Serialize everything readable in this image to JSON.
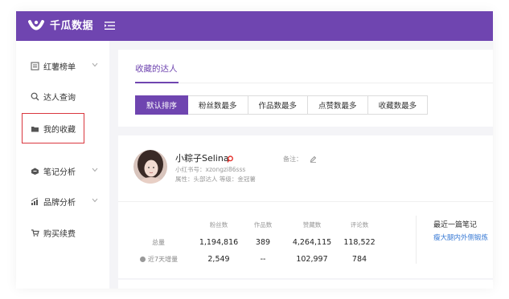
{
  "brand": {
    "name": "千瓜数据"
  },
  "colors": {
    "primary": "#6f45b0",
    "active_outline": "#d9363e",
    "link": "#3a7bd5"
  },
  "sidebar": {
    "items": [
      {
        "label": "红薯榜单",
        "icon": "list-icon",
        "has_chevron": true
      },
      {
        "label": "达人查询",
        "icon": "search-icon",
        "has_chevron": false
      },
      {
        "label": "我的收藏",
        "icon": "folder-icon",
        "has_chevron": false,
        "active": true
      },
      {
        "label": "笔记分析",
        "icon": "note-analysis-icon",
        "has_chevron": true
      },
      {
        "label": "品牌分析",
        "icon": "bar-chart-icon",
        "has_chevron": true
      },
      {
        "label": "购买续费",
        "icon": "cart-icon",
        "has_chevron": false
      }
    ]
  },
  "main": {
    "tab_title": "收藏的达人",
    "sort_buttons": [
      "默认排序",
      "粉丝数最多",
      "作品数最多",
      "点赞数最多",
      "收藏数最多"
    ]
  },
  "influencer": {
    "name": "小粽子Selina",
    "redbook_id": "小红书号：xzongzi86sss",
    "attributes": "属性：头部达人   等级：金冠薯",
    "note_label": "备注：",
    "stats": {
      "headers": [
        "粉丝数",
        "作品数",
        "赞藏数",
        "评论数"
      ],
      "total_label": "总量",
      "total_values": [
        "1,194,816",
        "389",
        "4,264,115",
        "118,522"
      ],
      "week_label": "近7天增量",
      "week_values": [
        "2,549",
        "--",
        "102,997",
        "784"
      ]
    },
    "latest_note_title": "最近一篇笔记",
    "latest_note_link": "瘦大腿内外侧锻炼"
  }
}
